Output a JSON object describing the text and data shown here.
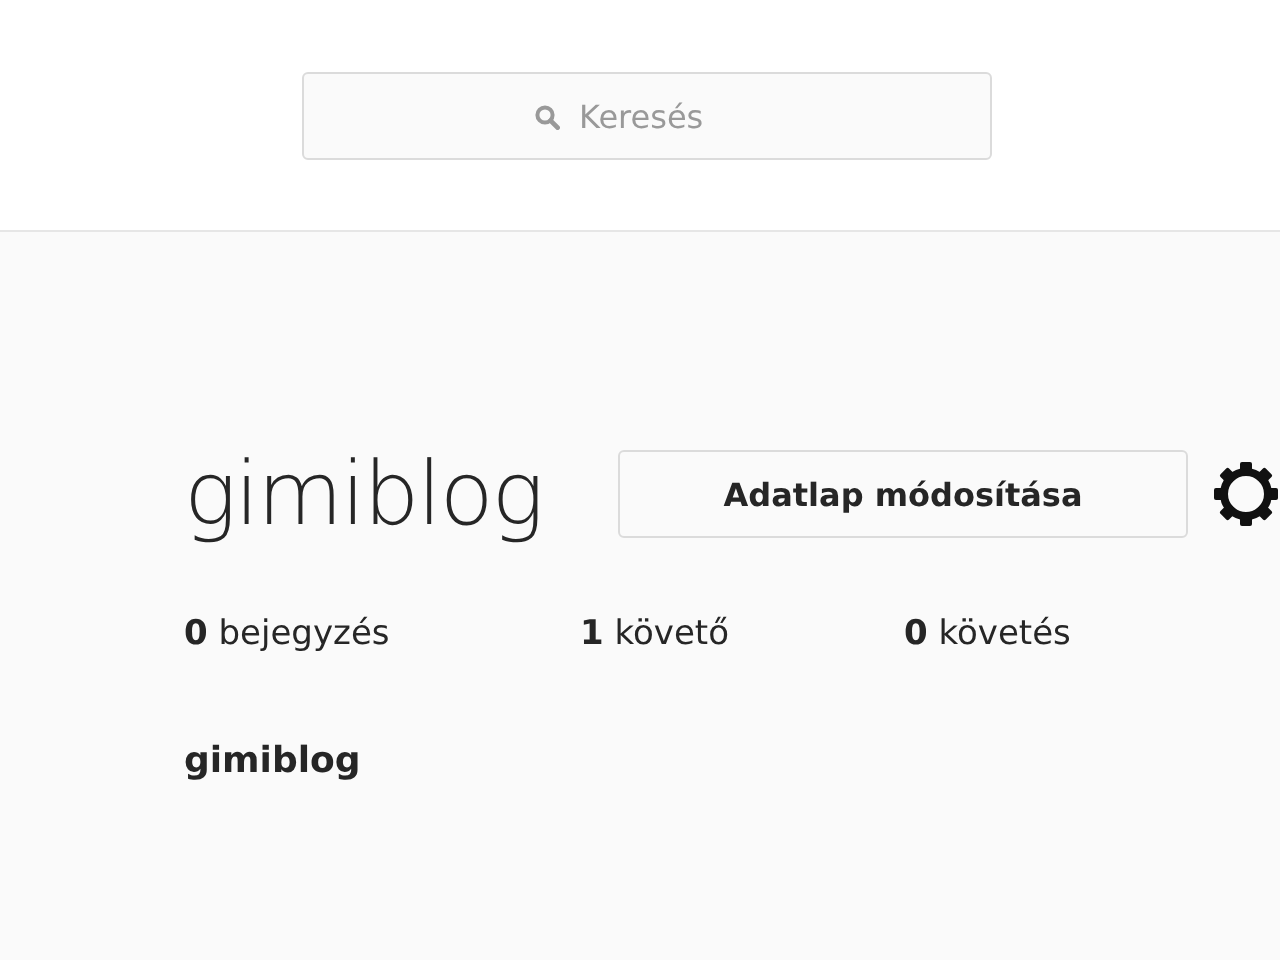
{
  "search": {
    "placeholder": "Keresés"
  },
  "profile": {
    "username": "gimiblog",
    "edit_button": "Adatlap módosítása",
    "stats": [
      "**0** bejegyzés",
      "**1** követő",
      "**0** követés"
    ],
    "full_name": "gimiblog"
  }
}
